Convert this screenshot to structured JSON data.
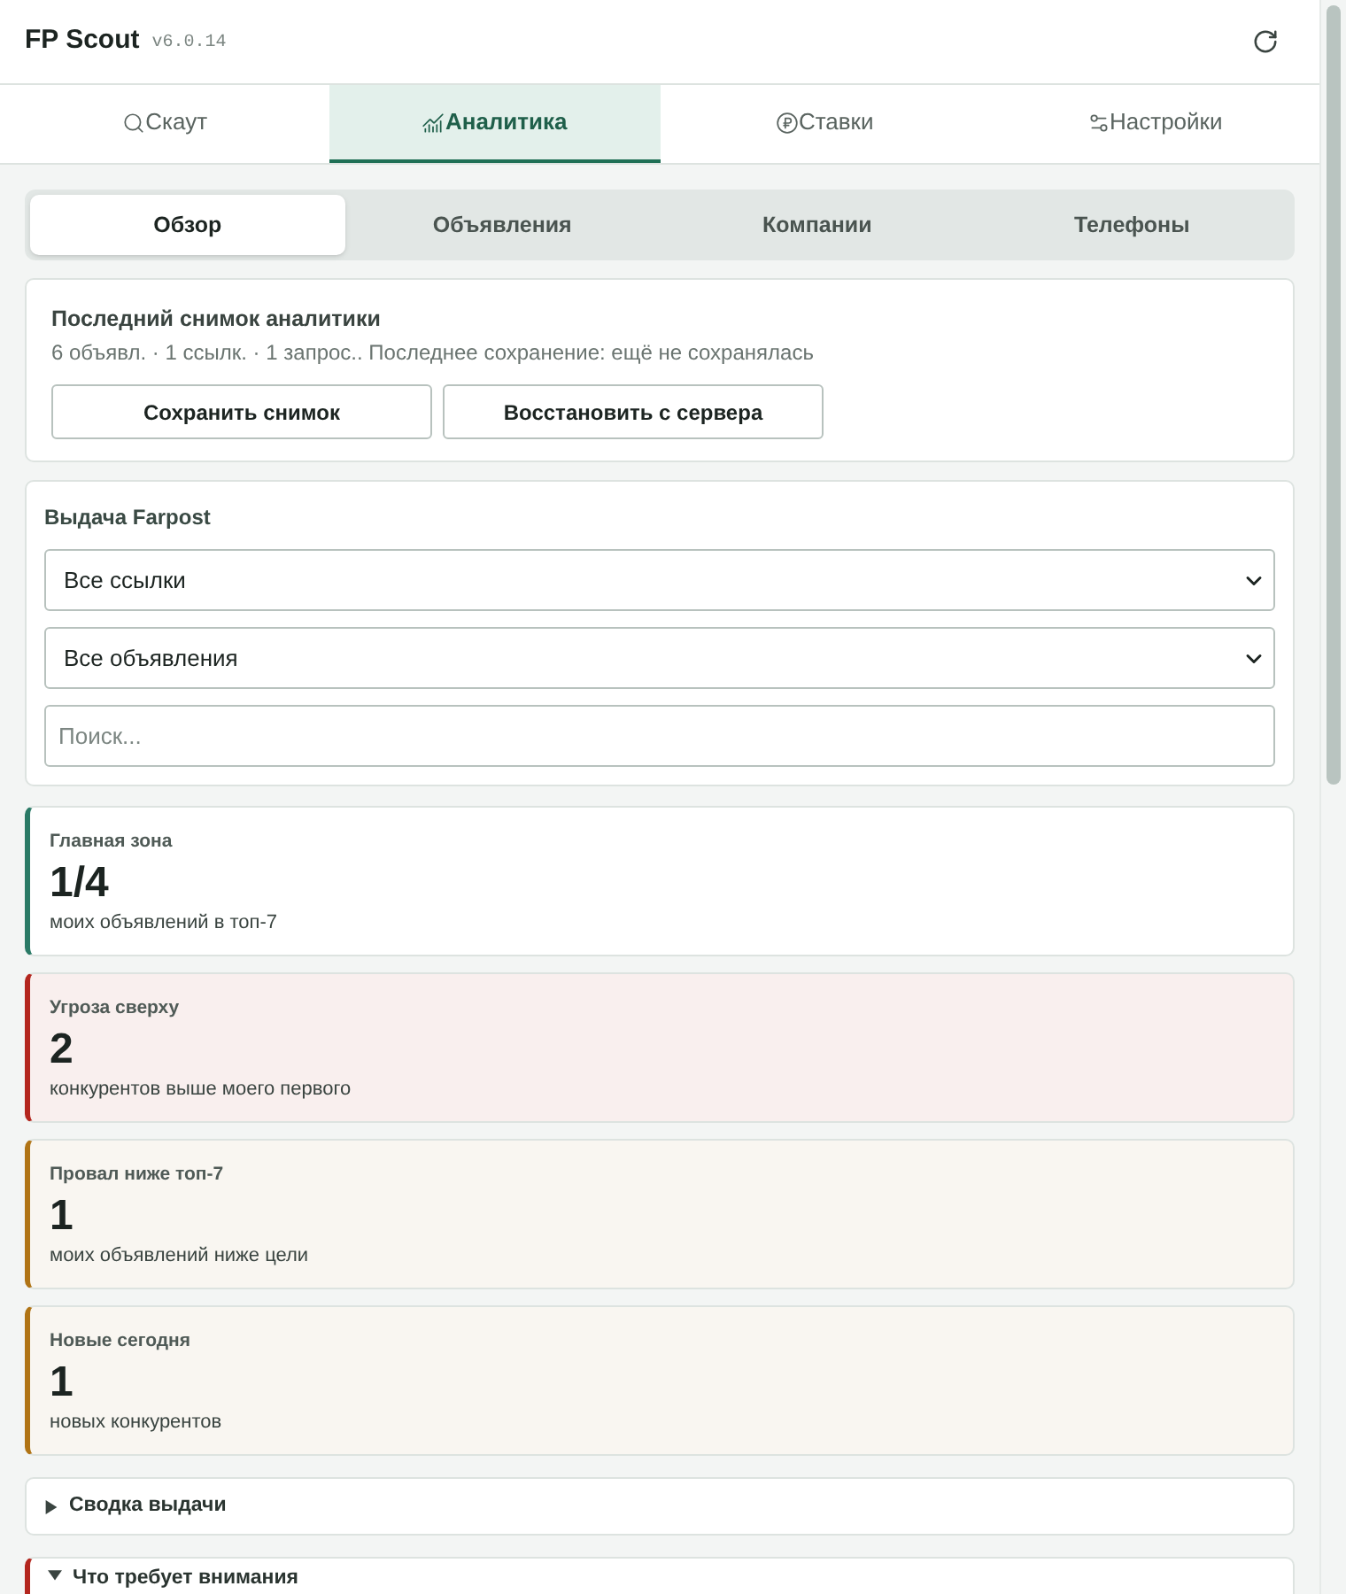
{
  "app": {
    "title": "FP Scout",
    "version": "v6.0.14"
  },
  "tabs": [
    {
      "label": "Скаут",
      "selected": false
    },
    {
      "label": "Аналитика",
      "selected": true
    },
    {
      "label": "Ставки",
      "selected": false
    },
    {
      "label": "Настройки",
      "selected": false
    }
  ],
  "subtabs": [
    {
      "label": "Обзор",
      "selected": true
    },
    {
      "label": "Объявления",
      "selected": false
    },
    {
      "label": "Компании",
      "selected": false
    },
    {
      "label": "Телефоны",
      "selected": false
    }
  ],
  "snapshot": {
    "title": "Последний снимок аналитики",
    "summary": "6 объявл. · 1 ссылк. · 1 запрос.. Последнее сохранение: ещё не сохранялась",
    "buttons": [
      "Сохранить снимок",
      "Восстановить с сервера"
    ]
  },
  "filters": {
    "title": "Выдача Farpost",
    "selects": [
      "Все ссылки",
      "Все объявления"
    ],
    "search": {
      "placeholder": "Поиск..."
    }
  },
  "stats": [
    {
      "kind": "good",
      "title": "Главная зона",
      "value": "1/4",
      "caption": "моих объявлений в топ-7"
    },
    {
      "kind": "danger",
      "title": "Угроза сверху",
      "value": "2",
      "caption": "конкурентов выше моего первого"
    },
    {
      "kind": "warning",
      "title": "Провал ниже топ-7",
      "value": "1",
      "caption": "моих объявлений ниже цели"
    },
    {
      "kind": "warning",
      "title": "Новые сегодня",
      "value": "1",
      "caption": "новых конкурентов"
    }
  ],
  "sections": [
    {
      "kind": "plain",
      "title": "Сводка выдачи",
      "expanded": false
    },
    {
      "kind": "danger",
      "title": "Что требует внимания",
      "expanded": true
    }
  ]
}
